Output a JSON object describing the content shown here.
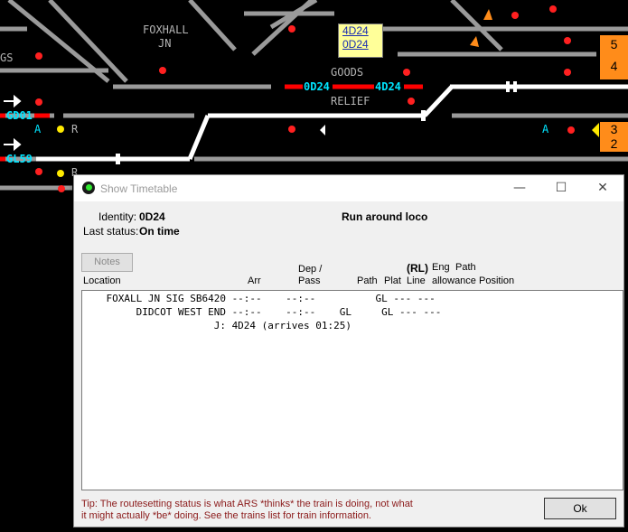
{
  "signalling": {
    "labels": {
      "foxhall": "FOXHALL",
      "jn": "JN",
      "goods": "GOODS",
      "relief": "RELIEF",
      "gs": "GS",
      "aspect_a1": "A",
      "aspect_r1": "R",
      "aspect_a2": "A",
      "aspect_r2": "R"
    },
    "berths": {
      "b1": "0D24",
      "b2": "4D24",
      "gd01": "GD01",
      "gl59": "GL59"
    },
    "popup": {
      "line1": "4D24",
      "line2": "0D24"
    },
    "panels": {
      "top_a": "5",
      "top_b": "4",
      "bottom_a": "3",
      "bottom_b": "2"
    },
    "colors": {
      "background": "#000000",
      "track": "#9a9a9a",
      "set_route": "#ffffff",
      "occupied": "#ff0000",
      "berth": "#00e5ff",
      "panel": "#ff8c1a",
      "popup": "#ffff99"
    }
  },
  "dialog": {
    "title": "Show Timetable",
    "icon": "green-signal-icon",
    "controls": {
      "minimize": "—",
      "maximize": "☐",
      "close": "✕"
    },
    "identity_label": "Identity:",
    "identity_value": "0D24",
    "status_label": "Last status:",
    "status_value": "On time",
    "description": "Run around loco",
    "notes_button": "Notes",
    "columns": {
      "location": "Location",
      "arr": "Arr",
      "dep_pass_1": "Dep /",
      "dep_pass_2": "Pass",
      "path": "Path",
      "plat": "Plat",
      "rl": "(RL)",
      "line": "Line",
      "eng_1": "Eng",
      "eng_2": "allowance",
      "path_1": "Path",
      "path_2": "Position"
    },
    "rows": [
      "    FOXALL JN SIG SB6420 --:--    --:--          GL --- ---",
      "         DIDCOT WEST END --:--    --:--    GL     GL --- ---",
      "                      J: 4D24 (arrives 01:25)"
    ],
    "tip_line1": "Tip: The routesetting status is what ARS *thinks* the train is doing, not what",
    "tip_line2": "it might actually *be* doing. See the trains list for train information.",
    "ok_button": "Ok"
  }
}
